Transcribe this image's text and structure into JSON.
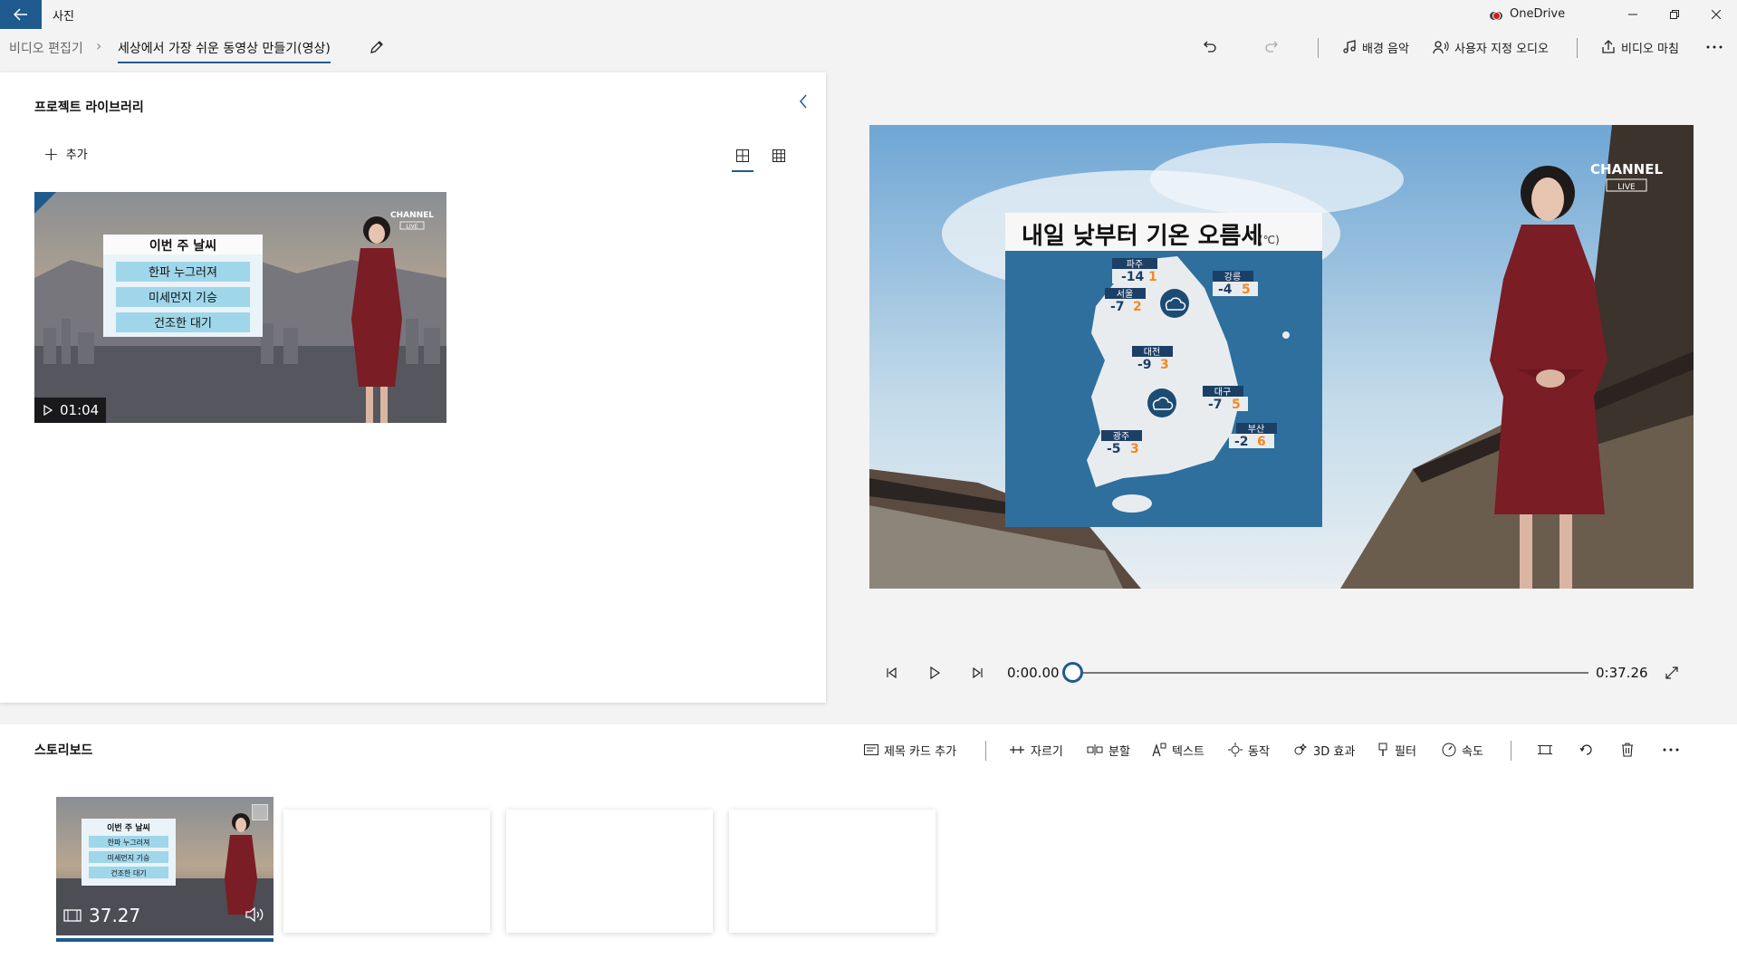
{
  "titlebar": {
    "app_name": "사진",
    "onedrive_label": "OneDrive",
    "controls": [
      "minimize-icon",
      "restore-icon",
      "close-icon"
    ]
  },
  "breadcrumb": {
    "root": "비디오 편집기",
    "current": "세상에서 가장 쉬운 동영상 만들기(영상)"
  },
  "commands": {
    "background_music": "배경 음악",
    "custom_audio": "사용자 지정 오디오",
    "finish_video": "비디오 마침"
  },
  "library": {
    "title": "프로젝트 라이브러리",
    "add_label": "추가",
    "thumbnail": {
      "duration": "01:04",
      "board_title": "이번 주 날씨",
      "board_items": [
        "한파 누그러져",
        "미세먼지 기승",
        "건조한 대기"
      ],
      "logo_line1": "CHANNEL",
      "logo_line2": "LIVE"
    }
  },
  "preview": {
    "headline": "내일 낮부터 기온 오름세",
    "unit": "(℃)",
    "logo_line1": "CHANNEL",
    "logo_line2": "LIVE",
    "cities": [
      {
        "name": "파주",
        "low": "-14",
        "high": "1"
      },
      {
        "name": "강릉",
        "low": "-4",
        "high": "5"
      },
      {
        "name": "서울",
        "low": "-7",
        "high": "2"
      },
      {
        "name": "대전",
        "low": "-9",
        "high": "3"
      },
      {
        "name": "대구",
        "low": "-7",
        "high": "5"
      },
      {
        "name": "부산",
        "low": "-2",
        "high": "6"
      },
      {
        "name": "광주",
        "low": "-5",
        "high": "3"
      }
    ]
  },
  "playback": {
    "current_time": "0:00.00",
    "total_time": "0:37.26",
    "progress": 0
  },
  "storyboard": {
    "title": "스토리보드",
    "tools": {
      "title_card": "제목 카드 추가",
      "trim": "자르기",
      "split": "분할",
      "text": "텍스트",
      "motion": "동작",
      "effects_3d": "3D 효과",
      "filters": "필터",
      "speed": "속도"
    },
    "clip": {
      "duration": "37.27",
      "board_title": "이번 주 날씨",
      "board_items": [
        "한파 누그러져",
        "미세먼지 기승",
        "건조한 대기"
      ]
    }
  },
  "colors": {
    "accent": "#1f5a8e",
    "map_blue": "#2e6f9e",
    "temp_high": "#f08a24"
  }
}
